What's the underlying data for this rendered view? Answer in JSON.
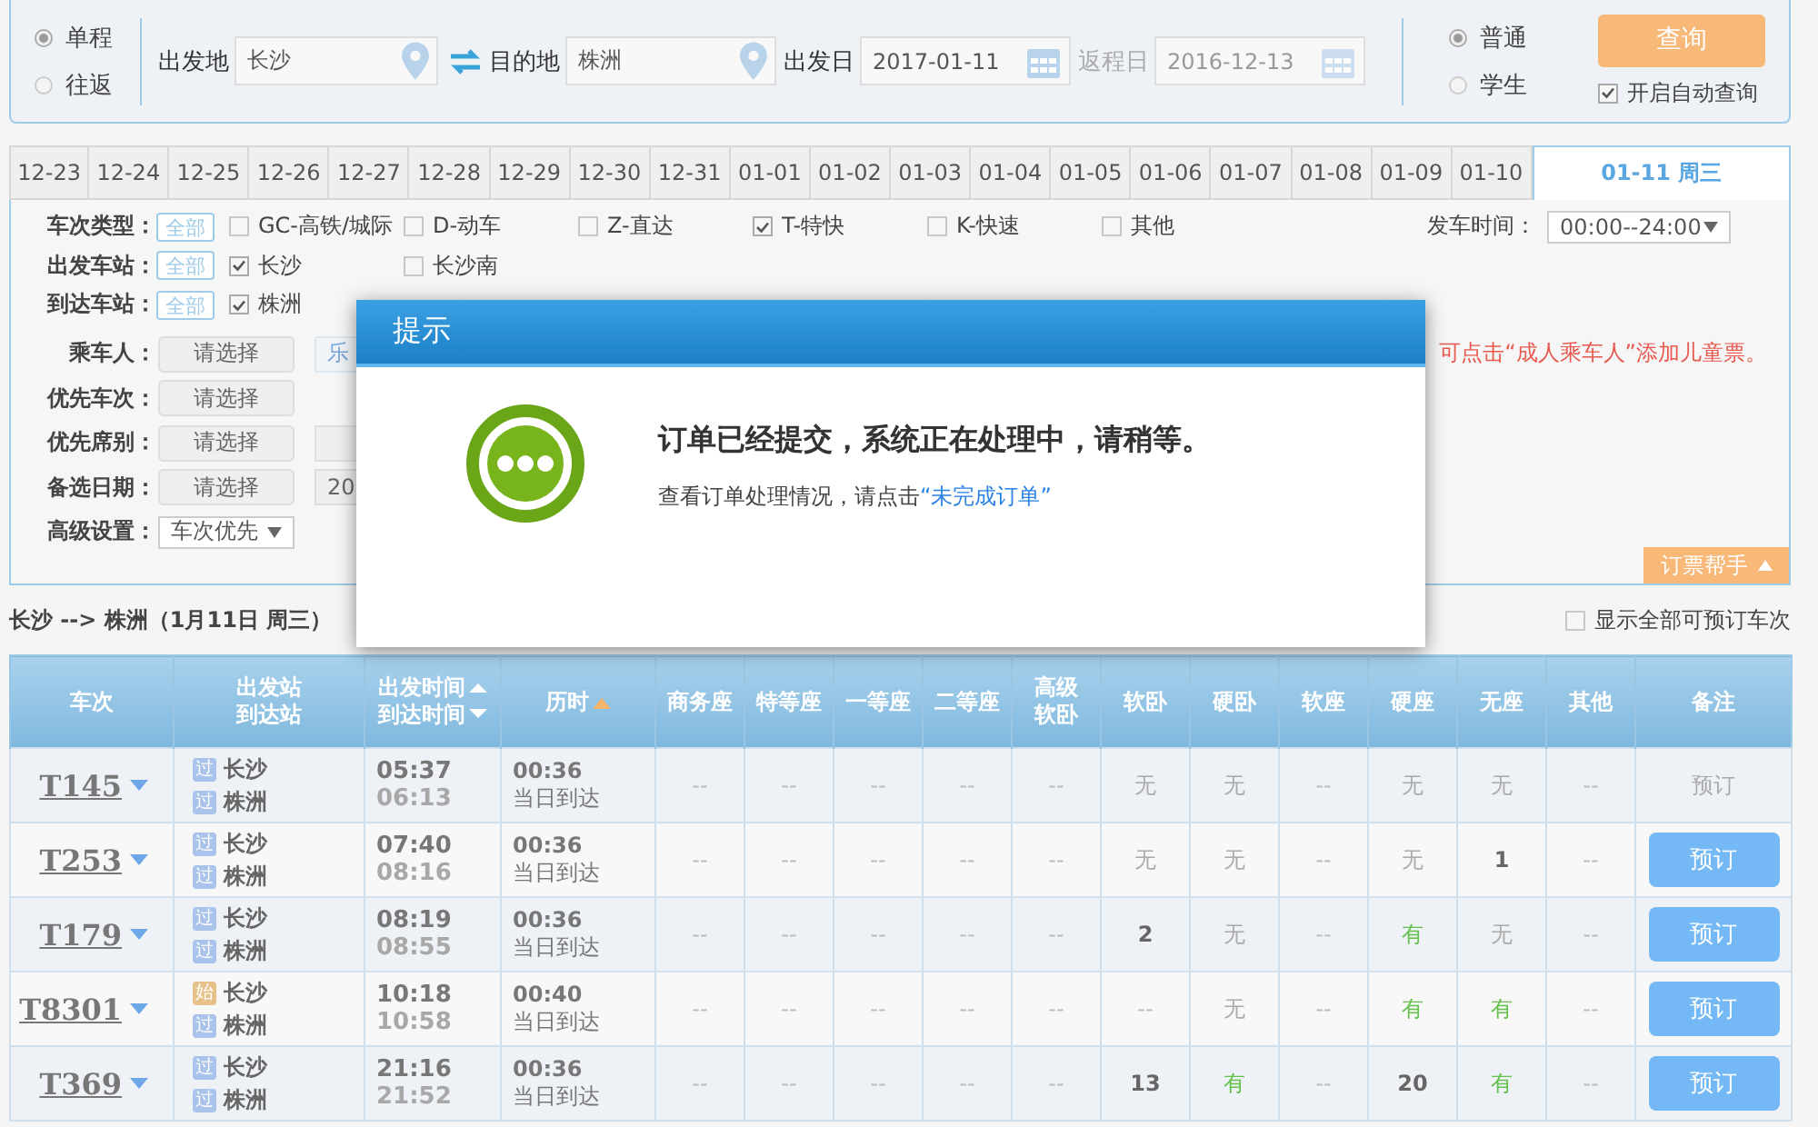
{
  "trip_type": [
    {
      "label": "单程",
      "selected": true
    },
    {
      "label": "往返",
      "selected": false
    }
  ],
  "from": {
    "label": "出发地",
    "value": "长沙"
  },
  "to": {
    "label": "目的地",
    "value": "株洲"
  },
  "depart_date": {
    "label": "出发日",
    "value": "2017-01-11",
    "disabled": false
  },
  "return_date": {
    "label": "返程日",
    "value": "2016-12-13",
    "disabled": true
  },
  "passenger_type": [
    {
      "label": "普通",
      "selected": true
    },
    {
      "label": "学生",
      "selected": false
    }
  ],
  "search_button": "查询",
  "auto_query": {
    "label": "开启自动查询",
    "checked": true
  },
  "date_tabs": [
    {
      "label": "12-23",
      "selected": false
    },
    {
      "label": "12-24",
      "selected": false
    },
    {
      "label": "12-25",
      "selected": false
    },
    {
      "label": "12-26",
      "selected": false
    },
    {
      "label": "12-27",
      "selected": false
    },
    {
      "label": "12-28",
      "selected": false
    },
    {
      "label": "12-29",
      "selected": false
    },
    {
      "label": "12-30",
      "selected": false
    },
    {
      "label": "12-31",
      "selected": false
    },
    {
      "label": "01-01",
      "selected": false
    },
    {
      "label": "01-02",
      "selected": false
    },
    {
      "label": "01-03",
      "selected": false
    },
    {
      "label": "01-04",
      "selected": false
    },
    {
      "label": "01-05",
      "selected": false
    },
    {
      "label": "01-06",
      "selected": false
    },
    {
      "label": "01-07",
      "selected": false
    },
    {
      "label": "01-08",
      "selected": false
    },
    {
      "label": "01-09",
      "selected": false
    },
    {
      "label": "01-10",
      "selected": false
    },
    {
      "label": "01-11 周三",
      "selected": true
    }
  ],
  "filters": {
    "train_type": {
      "label": "车次类型：",
      "all": "全部",
      "options": [
        {
          "label": "GC-高铁/城际",
          "checked": false
        },
        {
          "label": "D-动车",
          "checked": false
        },
        {
          "label": "Z-直达",
          "checked": false
        },
        {
          "label": "T-特快",
          "checked": true
        },
        {
          "label": "K-快速",
          "checked": false
        },
        {
          "label": "其他",
          "checked": false
        }
      ]
    },
    "depart_time": {
      "label": "发车时间：",
      "value": "00:00--24:00"
    },
    "depart_station": {
      "label": "出发车站：",
      "all": "全部",
      "options": [
        {
          "label": "长沙",
          "checked": true
        },
        {
          "label": "长沙南",
          "checked": false
        }
      ]
    },
    "arrive_station": {
      "label": "到达车站：",
      "all": "全部",
      "options": [
        {
          "label": "株洲",
          "checked": true
        }
      ]
    },
    "passengers": {
      "label": "乘车人：",
      "button": "请选择",
      "chip": "乐"
    },
    "note": "可点击“成人乘车人”添加儿童票。",
    "priority_train": {
      "label": "优先车次：",
      "button": "请选择"
    },
    "priority_seat": {
      "label": "优先席别：",
      "button": "请选择"
    },
    "alt_date": {
      "label": "备选日期：",
      "button": "请选择",
      "value": "20"
    },
    "advanced": {
      "label": "高级设置：",
      "value": "车次优先"
    }
  },
  "helper_tab": "订票帮手",
  "route_summary": "长沙 --> 株洲（1月11日  周三）",
  "show_all": {
    "label": "显示全部可预订车次",
    "checked": false
  },
  "table": {
    "columns": [
      {
        "lines": [
          "车次"
        ],
        "sortable": false
      },
      {
        "lines": [
          "出发站",
          "到达站"
        ],
        "sortable": false
      },
      {
        "lines": [
          "出发时间",
          "到达时间"
        ],
        "sortable": true,
        "sort_active": false
      },
      {
        "lines": [
          "历时"
        ],
        "sortable": true,
        "sort_active": true
      },
      {
        "lines": [
          "商务座"
        ],
        "sortable": false
      },
      {
        "lines": [
          "特等座"
        ],
        "sortable": false
      },
      {
        "lines": [
          "一等座"
        ],
        "sortable": false
      },
      {
        "lines": [
          "二等座"
        ],
        "sortable": false
      },
      {
        "lines": [
          "高级",
          "软卧"
        ],
        "sortable": false
      },
      {
        "lines": [
          "软卧"
        ],
        "sortable": false
      },
      {
        "lines": [
          "硬卧"
        ],
        "sortable": false
      },
      {
        "lines": [
          "软座"
        ],
        "sortable": false
      },
      {
        "lines": [
          "硬座"
        ],
        "sortable": false
      },
      {
        "lines": [
          "无座"
        ],
        "sortable": false
      },
      {
        "lines": [
          "其他"
        ],
        "sortable": false
      },
      {
        "lines": [
          "备注"
        ],
        "sortable": false
      }
    ],
    "rows": [
      {
        "train": "T145",
        "from": {
          "badge": "过",
          "kind": "pass",
          "name": "长沙"
        },
        "to": {
          "badge": "过",
          "kind": "pass",
          "name": "株洲"
        },
        "depart": "05:37",
        "arrive": "06:13",
        "duration": "00:36",
        "arrival_day": "当日到达",
        "seats": [
          {
            "text": "--",
            "kind": "na"
          },
          {
            "text": "--",
            "kind": "na"
          },
          {
            "text": "--",
            "kind": "na"
          },
          {
            "text": "--",
            "kind": "na"
          },
          {
            "text": "--",
            "kind": "na"
          },
          {
            "text": "无",
            "kind": "none"
          },
          {
            "text": "无",
            "kind": "none"
          },
          {
            "text": "--",
            "kind": "na"
          },
          {
            "text": "无",
            "kind": "none"
          },
          {
            "text": "无",
            "kind": "none"
          },
          {
            "text": "--",
            "kind": "na"
          }
        ],
        "book": {
          "label": "预订",
          "disabled": true
        }
      },
      {
        "train": "T253",
        "from": {
          "badge": "过",
          "kind": "pass",
          "name": "长沙"
        },
        "to": {
          "badge": "过",
          "kind": "pass",
          "name": "株洲"
        },
        "depart": "07:40",
        "arrive": "08:16",
        "duration": "00:36",
        "arrival_day": "当日到达",
        "seats": [
          {
            "text": "--",
            "kind": "na"
          },
          {
            "text": "--",
            "kind": "na"
          },
          {
            "text": "--",
            "kind": "na"
          },
          {
            "text": "--",
            "kind": "na"
          },
          {
            "text": "--",
            "kind": "na"
          },
          {
            "text": "无",
            "kind": "none"
          },
          {
            "text": "无",
            "kind": "none"
          },
          {
            "text": "--",
            "kind": "na"
          },
          {
            "text": "无",
            "kind": "none"
          },
          {
            "text": "1",
            "kind": "count"
          },
          {
            "text": "--",
            "kind": "na"
          }
        ],
        "book": {
          "label": "预订",
          "disabled": false
        }
      },
      {
        "train": "T179",
        "from": {
          "badge": "过",
          "kind": "pass",
          "name": "长沙"
        },
        "to": {
          "badge": "过",
          "kind": "pass",
          "name": "株洲"
        },
        "depart": "08:19",
        "arrive": "08:55",
        "duration": "00:36",
        "arrival_day": "当日到达",
        "seats": [
          {
            "text": "--",
            "kind": "na"
          },
          {
            "text": "--",
            "kind": "na"
          },
          {
            "text": "--",
            "kind": "na"
          },
          {
            "text": "--",
            "kind": "na"
          },
          {
            "text": "--",
            "kind": "na"
          },
          {
            "text": "2",
            "kind": "count"
          },
          {
            "text": "无",
            "kind": "none"
          },
          {
            "text": "--",
            "kind": "na"
          },
          {
            "text": "有",
            "kind": "avail"
          },
          {
            "text": "无",
            "kind": "none"
          },
          {
            "text": "--",
            "kind": "na"
          }
        ],
        "book": {
          "label": "预订",
          "disabled": false
        }
      },
      {
        "train": "T8301",
        "from": {
          "badge": "始",
          "kind": "start",
          "name": "长沙"
        },
        "to": {
          "badge": "过",
          "kind": "pass",
          "name": "株洲"
        },
        "depart": "10:18",
        "arrive": "10:58",
        "duration": "00:40",
        "arrival_day": "当日到达",
        "seats": [
          {
            "text": "--",
            "kind": "na"
          },
          {
            "text": "--",
            "kind": "na"
          },
          {
            "text": "--",
            "kind": "na"
          },
          {
            "text": "--",
            "kind": "na"
          },
          {
            "text": "--",
            "kind": "na"
          },
          {
            "text": "--",
            "kind": "na"
          },
          {
            "text": "无",
            "kind": "none"
          },
          {
            "text": "--",
            "kind": "na"
          },
          {
            "text": "有",
            "kind": "avail"
          },
          {
            "text": "有",
            "kind": "avail"
          },
          {
            "text": "--",
            "kind": "na"
          }
        ],
        "book": {
          "label": "预订",
          "disabled": false
        }
      },
      {
        "train": "T369",
        "from": {
          "badge": "过",
          "kind": "pass",
          "name": "长沙"
        },
        "to": {
          "badge": "过",
          "kind": "pass",
          "name": "株洲"
        },
        "depart": "21:16",
        "arrive": "21:52",
        "duration": "00:36",
        "arrival_day": "当日到达",
        "seats": [
          {
            "text": "--",
            "kind": "na"
          },
          {
            "text": "--",
            "kind": "na"
          },
          {
            "text": "--",
            "kind": "na"
          },
          {
            "text": "--",
            "kind": "na"
          },
          {
            "text": "--",
            "kind": "na"
          },
          {
            "text": "13",
            "kind": "count"
          },
          {
            "text": "有",
            "kind": "avail"
          },
          {
            "text": "--",
            "kind": "na"
          },
          {
            "text": "20",
            "kind": "count"
          },
          {
            "text": "有",
            "kind": "avail"
          },
          {
            "text": "--",
            "kind": "na"
          }
        ],
        "book": {
          "label": "预订",
          "disabled": false
        }
      }
    ]
  },
  "dialog": {
    "title": "提示",
    "message": "订单已经提交，系统正在处理中，请稍等。",
    "detail": "查看订单处理情况，请点击",
    "link": "“未完成订单”"
  }
}
